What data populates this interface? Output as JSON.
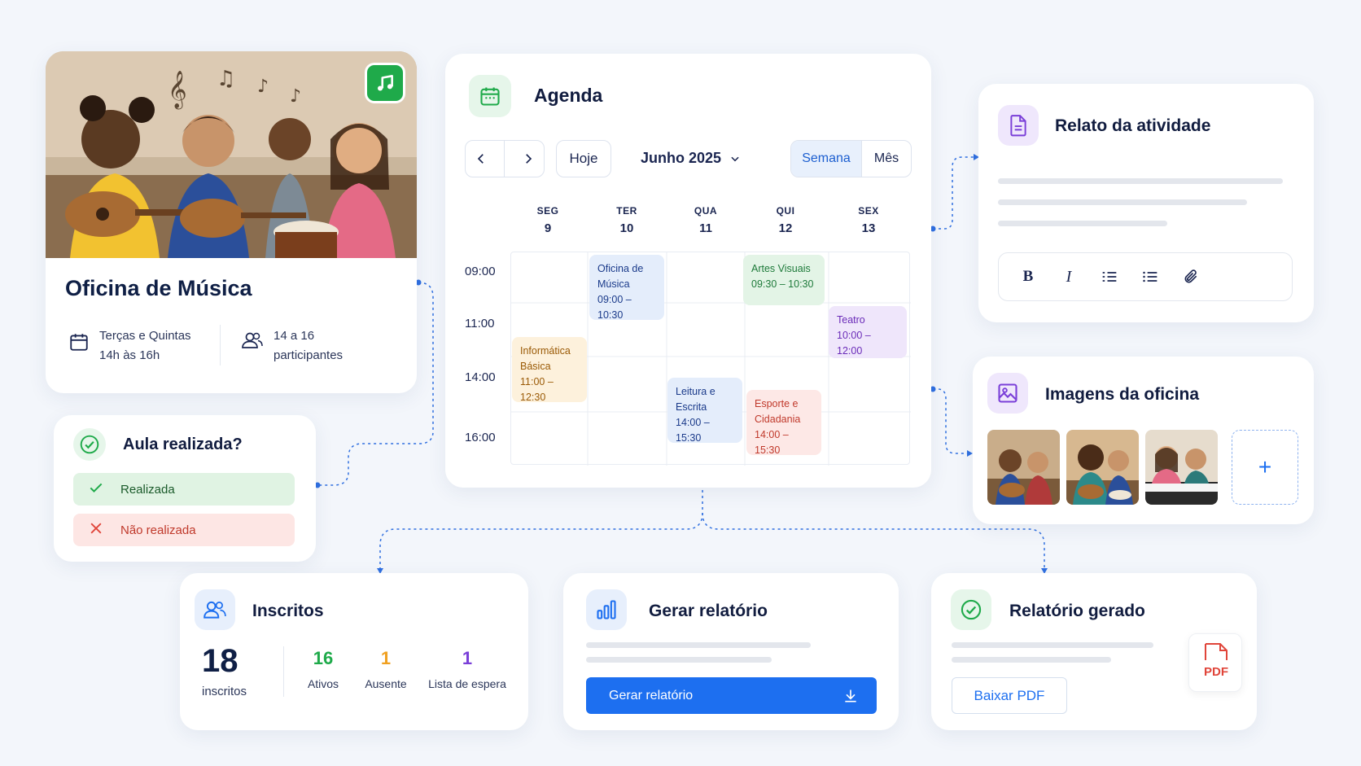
{
  "oficina": {
    "title": "Oficina de Música",
    "schedule_line1": "Terças e Quintas",
    "schedule_line2": "14h às 16h",
    "participants_line1": "14 a 16",
    "participants_line2": "participantes"
  },
  "aula": {
    "title": "Aula realizada?",
    "done_label": "Realizada",
    "not_done_label": "Não realizada"
  },
  "agenda": {
    "title": "Agenda",
    "today_label": "Hoje",
    "month_label": "Junho 2025",
    "view_week": "Semana",
    "view_month": "Mês",
    "days": [
      {
        "name": "SEG",
        "date": "9"
      },
      {
        "name": "TER",
        "date": "10"
      },
      {
        "name": "QUA",
        "date": "11"
      },
      {
        "name": "QUI",
        "date": "12"
      },
      {
        "name": "SEX",
        "date": "13"
      }
    ],
    "times": [
      "09:00",
      "11:00",
      "14:00",
      "16:00"
    ],
    "events": [
      {
        "title_line1": "Oficina de",
        "title_line2": "Música",
        "time": "09:00 – 10:30",
        "color": "#1a3a8a",
        "bg": "#e4edfb"
      },
      {
        "title_line1": "Artes Visuais",
        "title_line2": "",
        "time": "09:30 – 10:30",
        "color": "#1e7a3a",
        "bg": "#e3f4e6"
      },
      {
        "title_line1": "Teatro",
        "title_line2": "",
        "time": "10:00 – 12:00",
        "color": "#6a2bb8",
        "bg": "#efe6fb"
      },
      {
        "title_line1": "Informática",
        "title_line2": "Básica",
        "time": "11:00 – 12:30",
        "color": "#9a5a06",
        "bg": "#fdf1dc"
      },
      {
        "title_line1": "Leitura e",
        "title_line2": "Escrita",
        "time": "14:00 – 15:30",
        "color": "#1a3a8a",
        "bg": "#e4edfb"
      },
      {
        "title_line1": "Esporte e",
        "title_line2": "Cidadania",
        "time": "14:00 – 15:30",
        "color": "#c0392b",
        "bg": "#fde8e6"
      }
    ]
  },
  "relato": {
    "title": "Relato da atividade",
    "toolbar": {
      "bold": "B",
      "italic": "I"
    }
  },
  "imagens": {
    "title": "Imagens da oficina",
    "add_label": "+"
  },
  "inscritos": {
    "title": "Inscritos",
    "total": "18",
    "total_label": "inscritos",
    "stats": [
      {
        "value": "16",
        "label": "Ativos",
        "color": "#1faa4a"
      },
      {
        "value": "1",
        "label": "Ausente",
        "color": "#f0a020"
      },
      {
        "value": "1",
        "label": "Lista de espera",
        "color": "#7a3fd8"
      }
    ]
  },
  "gerar": {
    "title": "Gerar relatório",
    "button_label": "Gerar relatório"
  },
  "gerado": {
    "title": "Relatório gerado",
    "download_label": "Baixar PDF",
    "pdf_label": "PDF"
  },
  "colors": {
    "accent": "#1d6ff0",
    "green": "#1faa4a",
    "purple": "#7a3fd8",
    "red": "#e0453a"
  }
}
